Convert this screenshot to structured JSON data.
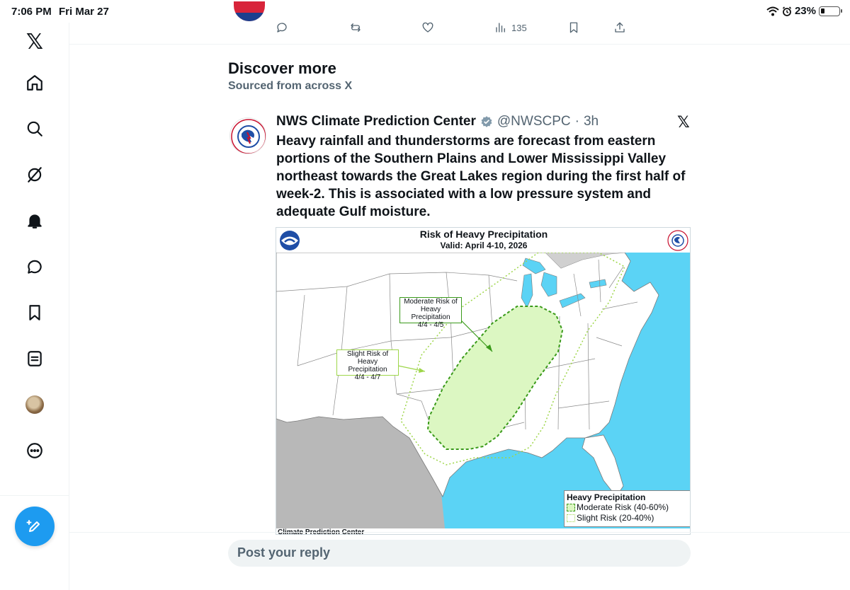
{
  "status_bar": {
    "time": "7:06 PM",
    "date": "Fri Mar 27",
    "battery_percent_label": "23%",
    "battery_level": 0.23
  },
  "sidebar": {
    "logo": "𝕏",
    "items": [
      {
        "name": "home",
        "icon": "home-icon"
      },
      {
        "name": "explore",
        "icon": "search-icon"
      },
      {
        "name": "grok",
        "icon": "grok-icon"
      },
      {
        "name": "notifications",
        "icon": "bell-icon"
      },
      {
        "name": "messages",
        "icon": "message-icon"
      },
      {
        "name": "bookmarks",
        "icon": "bookmark-icon"
      },
      {
        "name": "lists",
        "icon": "list-icon"
      },
      {
        "name": "profile",
        "icon": "avatar"
      },
      {
        "name": "more",
        "icon": "more-icon"
      }
    ],
    "compose_icon": "compose-icon"
  },
  "previous_post": {
    "actions": {
      "reply": "",
      "repost": "",
      "like": "",
      "views": "135"
    }
  },
  "discover": {
    "title": "Discover more",
    "subtitle": "Sourced from across X"
  },
  "post": {
    "author": "NWS Climate Prediction Center",
    "handle": "@NWSCPC",
    "separator": "·",
    "time": "3h",
    "x_label": "𝕏",
    "text": "Heavy rainfall and thunderstorms are forecast from eastern portions of the Southern Plains and Lower Mississippi Valley northeast towards the Great Lakes region during the first half of week-2. This is associated with a low pressure system and adequate Gulf moisture.",
    "image": {
      "title": "Risk of Heavy Precipitation",
      "valid": "Valid: April 4-10, 2026",
      "callout_moderate": [
        "Moderate Risk of",
        "Heavy Precipitation",
        "4/4 - 4/5"
      ],
      "callout_slight": [
        "Slight Risk of",
        "Heavy Precipitation",
        "4/4 - 4/7"
      ],
      "legend_title": "Heavy Precipitation",
      "legend_moderate": "Moderate Risk (40-60%)",
      "legend_slight": "Slight Risk (20-40%)",
      "footer": "Climate Prediction Center",
      "colors": {
        "ocean": "#5bd3f5",
        "land": "#ffffff",
        "mexico": "#b8b8b8",
        "moderate_fill": "#dcf7c2",
        "moderate_line": "#3a9a1a",
        "slight_line": "#9ed64a"
      }
    }
  },
  "reply": {
    "placeholder": "Post your reply"
  }
}
